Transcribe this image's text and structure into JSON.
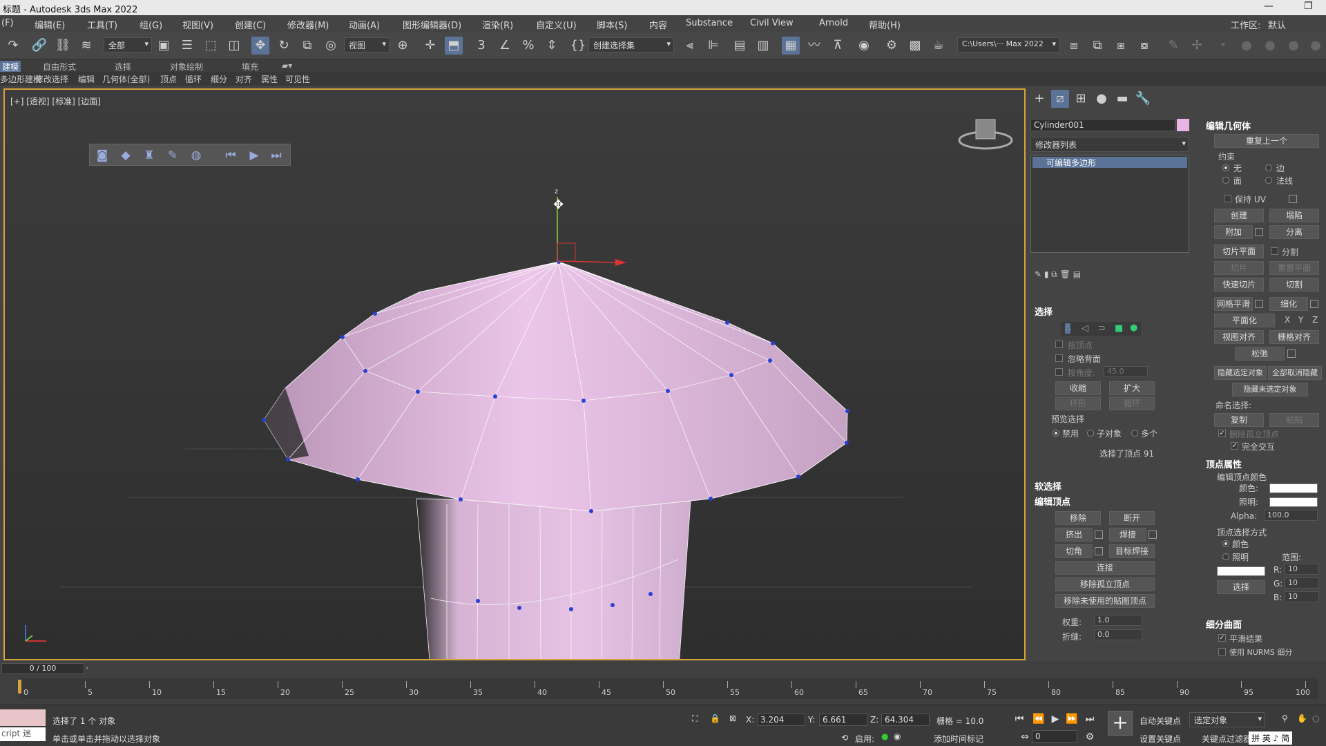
{
  "app": {
    "title": "标题 - Autodesk 3ds Max 2022",
    "workspace_label": "工作区:",
    "workspace_value": "默认"
  },
  "menu": [
    "(F)",
    "编辑(E)",
    "工具(T)",
    "组(G)",
    "视图(V)",
    "创建(C)",
    "修改器(M)",
    "动画(A)",
    "图形编辑器(D)",
    "渲染(R)",
    "自定义(U)",
    "脚本(S)",
    "内容",
    "Substance",
    "Civil View",
    "Arnold",
    "帮助(H)"
  ],
  "toolbar": {
    "selection_filter": "全部",
    "ref_coord": "视图",
    "named_sel": "创建选择集",
    "path": "C:\\Users\\··· Max 2022"
  },
  "ribbon_tabs": [
    "建模",
    "自由形式",
    "选择",
    "对象绘制",
    "填充"
  ],
  "ribbon_sub": [
    "多边形建模",
    "修改选择",
    "编辑",
    "几何体(全部)",
    "顶点",
    "循环",
    "细分",
    "对齐",
    "属性",
    "可见性"
  ],
  "viewport": {
    "label": "[+] [透视] [标准] [边面]",
    "gizmo_z": "z"
  },
  "panel": {
    "object_name": "Cylinder001",
    "object_color": "#e8b5e6",
    "modifier_list": "修改器列表",
    "stack_item": "可编辑多边形",
    "selection": {
      "title": "选择",
      "by_vertex": "按顶点",
      "ignore_back": "忽略背面",
      "by_angle": "按角度:",
      "angle_val": "45.0",
      "shrink": "收缩",
      "grow": "扩大",
      "ring": "环形",
      "loop": "循环",
      "preview_title": "预览选择",
      "disable": "禁用",
      "subobj": "子对象",
      "multi": "多个",
      "status": "选择了顶点 91"
    },
    "soft_sel": "软选择",
    "edit_verts": {
      "title": "编辑顶点",
      "remove": "移除",
      "break": "断开",
      "extrude": "挤出",
      "weld": "焊接",
      "chamfer": "切角",
      "target_weld": "目标焊接",
      "connect": "连接",
      "remove_iso": "移除孤立顶点",
      "remove_unused": "移除未使用的贴图顶点",
      "weight_label": "权重:",
      "weight": "1.0",
      "crease_label": "折缝:",
      "crease": "0.0"
    },
    "edit_geom": {
      "title": "编辑几何体",
      "repeat_last": "重复上一个",
      "constraints": "约束",
      "none": "无",
      "edge": "边",
      "face": "面",
      "normal": "法线",
      "preserve_uv": "保持 UV",
      "create": "创建",
      "collapse": "塌陷",
      "attach": "附加",
      "detach": "分离",
      "slice_plane": "切片平面",
      "split": "分割",
      "slice": "切片",
      "reset_plane": "重置平面",
      "quickslice": "快速切片",
      "cut": "切割",
      "meshsmooth": "网格平滑",
      "tessellate": "细化",
      "make_planar": "平面化",
      "x": "X",
      "y": "Y",
      "z": "Z",
      "view_align": "视图对齐",
      "grid_align": "栅格对齐",
      "relax": "松弛",
      "hide_sel": "隐藏选定对象",
      "unhide_all": "全部取消隐藏",
      "hide_unsel": "隐藏未选定对象",
      "named_sel": "命名选择:",
      "copy": "复制",
      "paste": "粘贴",
      "delete_iso": "删除孤立顶点",
      "full_interop": "完全交互"
    },
    "vert_props": {
      "title": "顶点属性",
      "edit_color": "编辑顶点颜色",
      "color": "颜色:",
      "illum": "照明:",
      "alpha": "Alpha:",
      "alpha_val": "100.0",
      "sel_by": "顶点选择方式",
      "by_color": "颜色",
      "by_illum": "照明",
      "range": "范围:",
      "r": "R:",
      "g": "G:",
      "b": "B:",
      "rv": "10",
      "gv": "10",
      "bv": "10",
      "select": "选择"
    },
    "subdiv": {
      "title": "细分曲面",
      "smooth_result": "平滑结果",
      "use_nurms": "使用 NURMS 细分"
    }
  },
  "timeline": {
    "frame": "0 / 100",
    "ticks": [
      "0",
      "5",
      "10",
      "15",
      "20",
      "25",
      "30",
      "35",
      "40",
      "45",
      "50",
      "55",
      "60",
      "65",
      "70",
      "75",
      "80",
      "85",
      "90",
      "95",
      "100"
    ]
  },
  "status": {
    "maxscript": "cript 迷",
    "selected": "选择了 1 个 对象",
    "prompt": "单击或单击并拖动以选择对象",
    "x_label": "X:",
    "x": "3.204",
    "y_label": "Y:",
    "y": "6.661",
    "z_label": "Z:",
    "z": "64.304",
    "grid": "栅格 = 10.0",
    "enable": "启用:",
    "add_tag": "添加时间标记",
    "autokey": "自动关键点",
    "setkey": "设置关键点",
    "sel_obj": "选定对象",
    "key_filter": "关键点过滤器",
    "frame_field": "0",
    "ime": "拼 英 ♪ 简"
  }
}
